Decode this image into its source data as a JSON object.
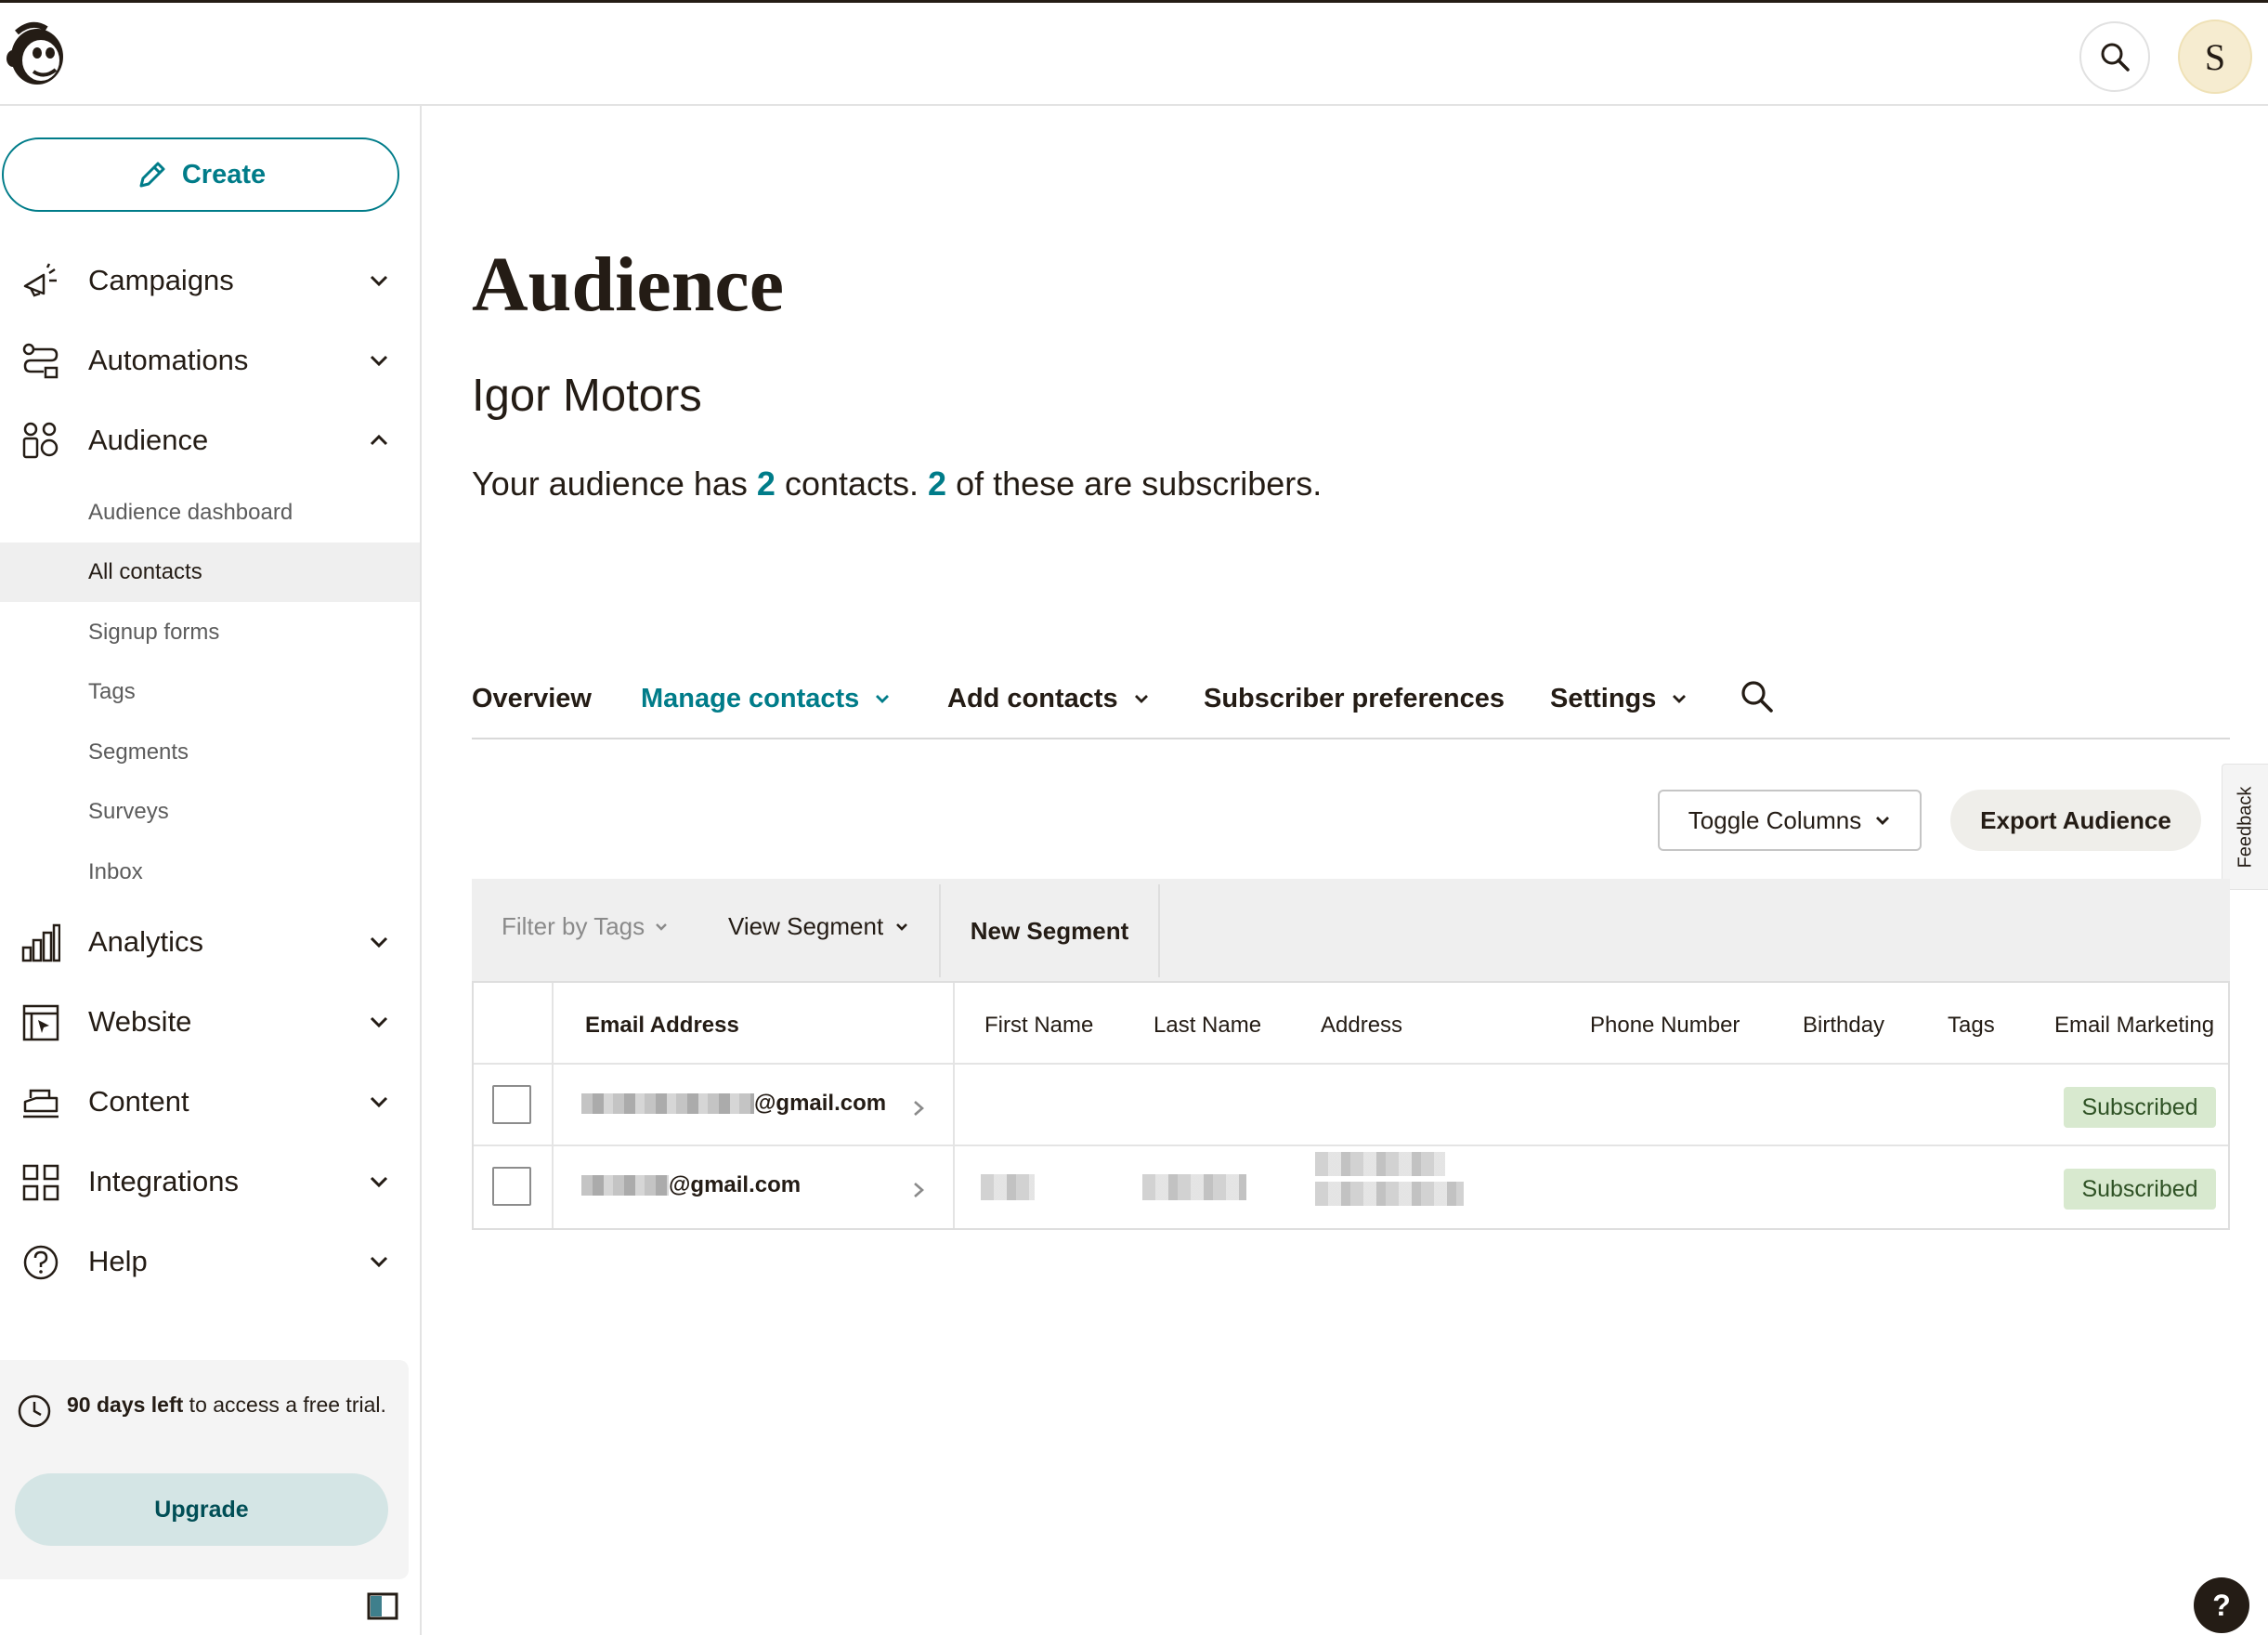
{
  "app": {
    "logo_icon": "mailchimp-freddie-logo-icon",
    "avatar_initial": "S"
  },
  "header": {
    "search_icon": "search-icon"
  },
  "sidebar": {
    "create_label": "Create",
    "nav": [
      {
        "id": "campaigns",
        "label": "Campaigns",
        "icon": "megaphone-icon",
        "expanded": false
      },
      {
        "id": "automations",
        "label": "Automations",
        "icon": "automation-flow-icon",
        "expanded": false
      },
      {
        "id": "audience",
        "label": "Audience",
        "icon": "audience-people-icon",
        "expanded": true
      },
      {
        "id": "analytics",
        "label": "Analytics",
        "icon": "bar-chart-icon",
        "expanded": false
      },
      {
        "id": "website",
        "label": "Website",
        "icon": "website-cursor-icon",
        "expanded": false
      },
      {
        "id": "content",
        "label": "Content",
        "icon": "content-stack-icon",
        "expanded": false
      },
      {
        "id": "integrations",
        "label": "Integrations",
        "icon": "grid-apps-icon",
        "expanded": false
      },
      {
        "id": "help",
        "label": "Help",
        "icon": "question-circle-icon",
        "expanded": false
      }
    ],
    "audience_sub": [
      {
        "label": "Audience dashboard",
        "active": false
      },
      {
        "label": "All contacts",
        "active": true
      },
      {
        "label": "Signup forms",
        "active": false
      },
      {
        "label": "Tags",
        "active": false
      },
      {
        "label": "Segments",
        "active": false
      },
      {
        "label": "Surveys",
        "active": false
      },
      {
        "label": "Inbox",
        "active": false
      }
    ],
    "trial": {
      "days_bold": "90 days left",
      "rest": " to access a free trial."
    },
    "upgrade_label": "Upgrade"
  },
  "main": {
    "title": "Audience",
    "audience_name": "Igor Motors",
    "summary": {
      "prefix": "Your audience has ",
      "contacts": "2",
      "mid": " contacts. ",
      "subscribers": "2",
      "suffix": " of these are subscribers."
    },
    "tabs": [
      {
        "label": "Overview",
        "active": false,
        "dropdown": false
      },
      {
        "label": "Manage contacts",
        "active": true,
        "dropdown": true
      },
      {
        "label": "Add contacts",
        "active": false,
        "dropdown": true
      },
      {
        "label": "Subscriber preferences",
        "active": false,
        "dropdown": false
      },
      {
        "label": "Settings",
        "active": false,
        "dropdown": true
      }
    ],
    "toggle_columns_label": "Toggle Columns",
    "export_label": "Export Audience",
    "feedback_label": "Feedback",
    "filter": {
      "tags_placeholder": "Filter by Tags",
      "view_segment": "View Segment",
      "new_segment": "New Segment"
    },
    "table": {
      "columns": [
        "Email Address",
        "First Name",
        "Last Name",
        "Address",
        "Phone Number",
        "Birthday",
        "Tags",
        "Email Marketing"
      ],
      "rows": [
        {
          "email_visible": "@gmail.com",
          "status": "Subscribed"
        },
        {
          "email_visible": "@gmail.com",
          "status": "Subscribed"
        }
      ]
    }
  },
  "help_fab": "?",
  "colors": {
    "accent": "#007c89",
    "text": "#241c15",
    "subscribed_bg": "#d8e9cf",
    "upgrade_bg": "#d4e5e5"
  }
}
